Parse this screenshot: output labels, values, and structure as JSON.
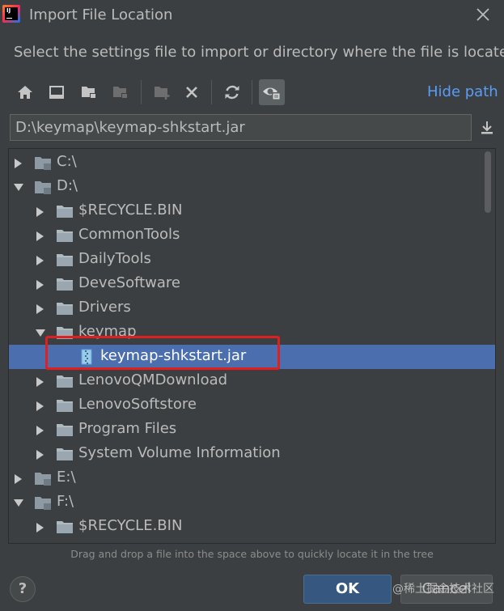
{
  "window": {
    "title": "Import File Location",
    "logo_text": "IJ",
    "close_icon": "close-icon"
  },
  "subtitle": "Select the settings file to import or directory where the file is located",
  "toolbar": {
    "buttons": [
      {
        "icon": "home-icon"
      },
      {
        "icon": "desktop-icon"
      },
      {
        "icon": "project-folder-icon"
      },
      {
        "icon": "module-folder-icon",
        "disabled": true
      },
      {
        "icon": "new-folder-icon",
        "disabled": true
      },
      {
        "icon": "delete-icon"
      },
      {
        "icon": "refresh-icon"
      },
      {
        "icon": "show-hidden-icon",
        "active": true
      }
    ],
    "hide_path_label": "Hide path"
  },
  "path": {
    "value": "D:\\keymap\\keymap-shkstart.jar"
  },
  "tree": {
    "items": [
      {
        "label": "C:\\",
        "depth": 0,
        "state": "collapsed",
        "type": "drive"
      },
      {
        "label": "D:\\",
        "depth": 0,
        "state": "expanded",
        "type": "drive"
      },
      {
        "label": "$RECYCLE.BIN",
        "depth": 1,
        "state": "collapsed",
        "type": "folder"
      },
      {
        "label": "CommonTools",
        "depth": 1,
        "state": "collapsed",
        "type": "folder"
      },
      {
        "label": "DailyTools",
        "depth": 1,
        "state": "collapsed",
        "type": "folder"
      },
      {
        "label": "DeveSoftware",
        "depth": 1,
        "state": "collapsed",
        "type": "folder"
      },
      {
        "label": "Drivers",
        "depth": 1,
        "state": "collapsed",
        "type": "folder"
      },
      {
        "label": "keymap",
        "depth": 1,
        "state": "expanded",
        "type": "folder"
      },
      {
        "label": "keymap-shkstart.jar",
        "depth": 2,
        "state": "leaf",
        "type": "jar",
        "selected": true
      },
      {
        "label": "LenovoQMDownload",
        "depth": 1,
        "state": "collapsed",
        "type": "folder"
      },
      {
        "label": "LenovoSoftstore",
        "depth": 1,
        "state": "collapsed",
        "type": "folder"
      },
      {
        "label": "Program Files",
        "depth": 1,
        "state": "collapsed",
        "type": "folder"
      },
      {
        "label": "System Volume Information",
        "depth": 1,
        "state": "collapsed",
        "type": "folder"
      },
      {
        "label": "E:\\",
        "depth": 0,
        "state": "collapsed",
        "type": "drive"
      },
      {
        "label": "F:\\",
        "depth": 0,
        "state": "expanded",
        "type": "drive"
      },
      {
        "label": "$RECYCLE.BIN",
        "depth": 1,
        "state": "collapsed",
        "type": "folder"
      }
    ]
  },
  "hint": "Drag and drop a file into the space above to quickly locate it in the tree",
  "buttons": {
    "help_label": "?",
    "ok_label": "OK",
    "cancel_label": "Cancel"
  },
  "watermark": "@稀土掘金技术社区",
  "colors": {
    "background": "#3c3f41",
    "selection": "#4b6eaf",
    "link": "#589df6",
    "ok_button": "#365880",
    "highlight_box": "#e02020"
  }
}
